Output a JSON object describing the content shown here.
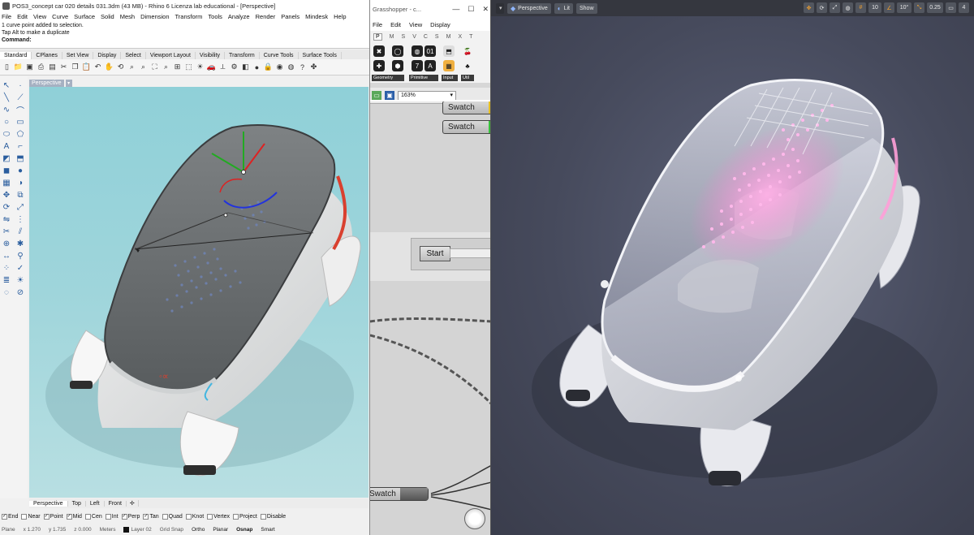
{
  "rhino": {
    "title": "POS3_concept car 020 details 031.3dm (43 MB) - Rhino 6 Licenza lab educational - [Perspective]",
    "menu": [
      "File",
      "Edit",
      "View",
      "Curve",
      "Surface",
      "Solid",
      "Mesh",
      "Dimension",
      "Transform",
      "Tools",
      "Analyze",
      "Render",
      "Panels",
      "Mindesk",
      "Help"
    ],
    "command_history": [
      "1 curve point added to selection.",
      "Tap Alt to make a duplicate"
    ],
    "command_prompt": "Command:",
    "toolbar_tabs": [
      "Standard",
      "CPlanes",
      "Set View",
      "Display",
      "Select",
      "Viewport Layout",
      "Visibility",
      "Transform",
      "Curve Tools",
      "Surface Tools"
    ],
    "active_toolbar_tab": "Standard",
    "viewport_label": "Perspective",
    "viewport_tabs": [
      "Perspective",
      "Top",
      "Left",
      "Front"
    ],
    "osnaps": [
      {
        "label": "End",
        "checked": true
      },
      {
        "label": "Near",
        "checked": false
      },
      {
        "label": "Point",
        "checked": true
      },
      {
        "label": "Mid",
        "checked": true
      },
      {
        "label": "Cen",
        "checked": false
      },
      {
        "label": "Int",
        "checked": false
      },
      {
        "label": "Perp",
        "checked": true
      },
      {
        "label": "Tan",
        "checked": true
      },
      {
        "label": "Quad",
        "checked": false
      },
      {
        "label": "Knot",
        "checked": false
      },
      {
        "label": "Vertex",
        "checked": false
      },
      {
        "label": "Project",
        "checked": false
      },
      {
        "label": "Disable",
        "checked": false
      }
    ],
    "status": {
      "plane": "Plane",
      "x": "x 1.270",
      "y": "y 1.735",
      "z": "z 0.000",
      "units": "Meters",
      "layer": "Layer 02",
      "grid_snap": "Grid Snap",
      "ortho": "Ortho",
      "planar": "Planar",
      "osnap": "Osnap",
      "smart": "Smart"
    }
  },
  "grasshopper": {
    "title": "Grasshopper - c...",
    "menu": [
      "File",
      "Edit",
      "View",
      "Display"
    ],
    "tabs": [
      "P",
      "M",
      "S",
      "V",
      "C",
      "S",
      "M",
      "X",
      "T"
    ],
    "active_tab": "P",
    "groups": [
      "Geometry",
      "Primitive",
      "Input",
      "Util"
    ],
    "zoom": "163%",
    "swatch_label_1": "Swatch",
    "swatch_label_2": "Swatch",
    "start_label": "Start",
    "bottom_swatch_label": "Swatch"
  },
  "render": {
    "perspective_label": "Perspective",
    "lit_label": "Lit",
    "show_label": "Show",
    "snap_value_1": "10",
    "snap_value_2": "10°",
    "snap_value_3": "0.25",
    "snap_value_4": "4"
  },
  "colors": {
    "rhino_bg": "#f0f0f0",
    "viewport_sky": "#9fd5db",
    "render_bg": "#464a5c",
    "accent_red": "#c43a2a",
    "glow_pink": "#ff9ed8"
  }
}
